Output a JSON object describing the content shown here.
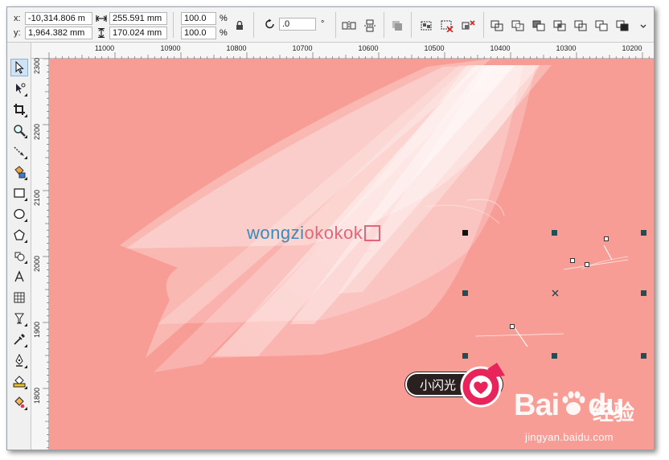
{
  "propbar": {
    "x_label": "x:",
    "x_value": "-10,314.806 m",
    "y_label": "y:",
    "y_value": "1,964.382 mm",
    "width_value": "255.591 mm",
    "height_value": "170.024 mm",
    "scale_x": "100.0",
    "scale_y": "100.0",
    "percent_1": "%",
    "percent_2": "%",
    "rotation_value": ".0",
    "degree": "°"
  },
  "ruler_h": [
    "11000",
    "10900",
    "10800",
    "10700",
    "10600",
    "10500",
    "10400",
    "10300",
    "10200"
  ],
  "ruler_v": [
    "2300",
    "2200",
    "2100",
    "2000",
    "1900",
    "1800"
  ],
  "canvas": {
    "background": "#f89d96",
    "logo_part1": "wongzi",
    "logo_part2": "okokok",
    "tooltip": "小闪光"
  },
  "watermark": {
    "brand": "Bai",
    "brand_mid": "du",
    "brand_cn": "经验",
    "url": "jingyan.baidu.com"
  },
  "icons": {
    "tools": [
      "pick-tool-icon",
      "shape-tool-icon",
      "crop-tool-icon",
      "zoom-tool-icon",
      "freehand-tool-icon",
      "smart-fill-icon",
      "rectangle-tool-icon",
      "ellipse-tool-icon",
      "polygon-tool-icon",
      "basic-shapes-icon",
      "text-tool-icon",
      "table-tool-icon",
      "interactive-tool-icon",
      "eyedropper-tool-icon",
      "outline-pen-icon",
      "fill-tool-icon",
      "interactive-fill-icon"
    ]
  }
}
